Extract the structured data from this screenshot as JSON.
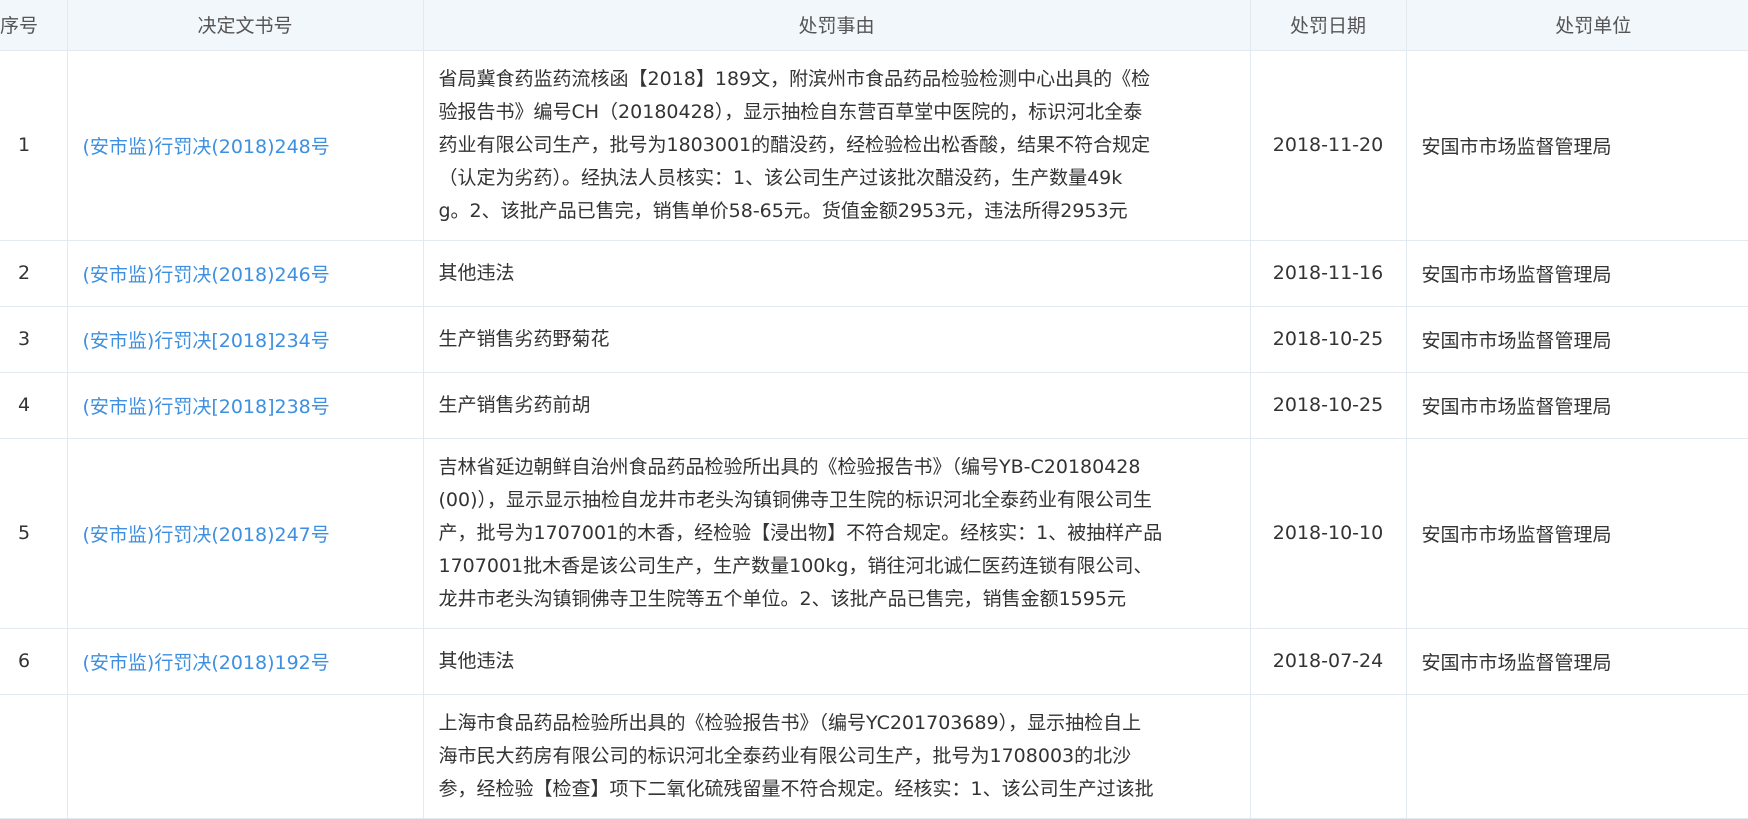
{
  "columns": {
    "index": "序号",
    "doc_no": "决定文书号",
    "reason": "处罚事由",
    "date": "处罚日期",
    "unit": "处罚单位"
  },
  "rows": [
    {
      "index": "1",
      "doc_no": "(安市监)行罚决(2018)248号",
      "reason_lines": [
        "省局冀食药监药流核函【2018】189文，附滨州市食品药品检验检测中心出具的《检",
        "验报告书》编号CH（20180428），显示抽检自东营百草堂中医院的，标识河北全泰",
        "药业有限公司生产，批号为1803001的醋没药，经检验检出松香酸，结果不符合规定",
        "（认定为劣药）。经执法人员核实：1、该公司生产过该批次醋没药，生产数量49k",
        "g。2、该批产品已售完，销售单价58-65元。货值金额2953元，违法所得2953元"
      ],
      "date": "2018-11-20",
      "unit": "安国市市场监督管理局"
    },
    {
      "index": "2",
      "doc_no": "(安市监)行罚决(2018)246号",
      "reason_lines": [
        "其他违法"
      ],
      "date": "2018-11-16",
      "unit": "安国市市场监督管理局"
    },
    {
      "index": "3",
      "doc_no": "(安市监)行罚决[2018]234号",
      "reason_lines": [
        "生产销售劣药野菊花"
      ],
      "date": "2018-10-25",
      "unit": "安国市市场监督管理局"
    },
    {
      "index": "4",
      "doc_no": "(安市监)行罚决[2018]238号",
      "reason_lines": [
        "生产销售劣药前胡"
      ],
      "date": "2018-10-25",
      "unit": "安国市市场监督管理局"
    },
    {
      "index": "5",
      "doc_no": "(安市监)行罚决(2018)247号",
      "reason_lines": [
        "吉林省延边朝鲜自治州食品药品检验所出具的《检验报告书》（编号YB-C20180428",
        "(00)），显示显示抽检自龙井市老头沟镇铜佛寺卫生院的标识河北全泰药业有限公司生",
        "产，批号为1707001的木香，经检验【浸出物】不符合规定。经核实：1、被抽样产品",
        "1707001批木香是该公司生产，生产数量100kg，销往河北诚仁医药连锁有限公司、",
        "龙井市老头沟镇铜佛寺卫生院等五个单位。2、该批产品已售完，销售金额1595元"
      ],
      "date": "2018-10-10",
      "unit": "安国市市场监督管理局"
    },
    {
      "index": "6",
      "doc_no": "(安市监)行罚决(2018)192号",
      "reason_lines": [
        "其他违法"
      ],
      "date": "2018-07-24",
      "unit": "安国市市场监督管理局"
    },
    {
      "index": "",
      "doc_no": "",
      "reason_lines": [
        "上海市食品药品检验所出具的《检验报告书》（编号YC201703689），显示抽检自上",
        "海市民大药房有限公司的标识河北全泰药业有限公司生产，批号为1708003的北沙",
        "参，经检验【检查】项下二氧化硫残留量不符合规定。经核实：1、该公司生产过该批"
      ],
      "date": "",
      "unit": ""
    }
  ]
}
